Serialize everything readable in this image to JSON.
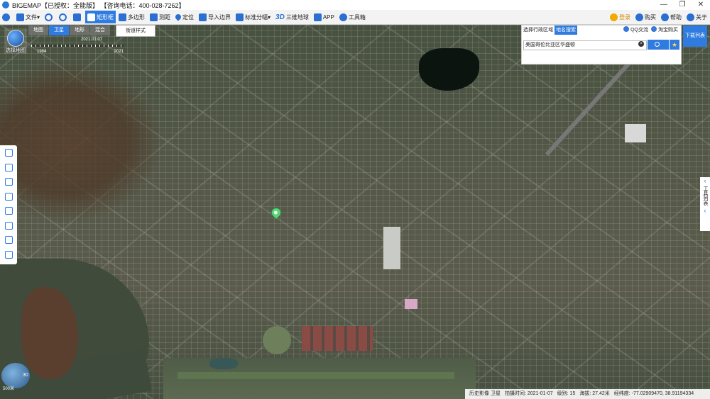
{
  "window": {
    "title": "BIGEMAP【已授权：全能版】 【咨询电话：400-028-7262】",
    "controls": [
      "—",
      "❐",
      "✕"
    ]
  },
  "toolbar": {
    "items": [
      {
        "label": "文件",
        "icon": "folder-icon"
      },
      {
        "label": "",
        "icon": "zoom-in-icon"
      },
      {
        "label": "",
        "icon": "zoom-out-icon"
      },
      {
        "label": "",
        "icon": "hand-icon"
      },
      {
        "label": "矩形框",
        "icon": "rectangle-icon",
        "active": true
      },
      {
        "label": "多边形",
        "icon": "polygon-icon"
      },
      {
        "label": "测距",
        "icon": "ruler-icon"
      },
      {
        "label": "定位",
        "icon": "pin-icon"
      },
      {
        "label": "导入边界",
        "icon": "import-icon"
      },
      {
        "label": "标准分幅",
        "icon": "grid-icon"
      },
      {
        "label": "三维地球",
        "icon": "3d-icon"
      },
      {
        "label": "APP",
        "icon": "phone-icon"
      },
      {
        "label": "工具箱",
        "icon": "gear-icon"
      }
    ],
    "right": [
      {
        "label": "登录",
        "icon": "user-icon"
      },
      {
        "label": "购买",
        "icon": "vip-icon"
      },
      {
        "label": "帮助",
        "icon": "help-icon"
      },
      {
        "label": "关于",
        "icon": "info-icon"
      }
    ]
  },
  "map_controls": {
    "select_map": "选择地图",
    "types": [
      "地图",
      "卫星",
      "地形",
      "混合"
    ],
    "active_type": "卫星",
    "street_style": "街道样式",
    "timeline": {
      "start": "1984",
      "end": "2021",
      "current": "2021.01.07"
    }
  },
  "search_panel": {
    "tabs": [
      "选择行政区域",
      "地名搜索"
    ],
    "active_tab": "地名搜索",
    "qq": "QQ交流",
    "taobao": "淘宝购买",
    "query": "美国哥伦比亚区华盛顿",
    "clear": "×",
    "star": "★"
  },
  "download_list": "下载列表",
  "right_panel": {
    "label": "工具列表"
  },
  "minimap": {
    "label": "30"
  },
  "scale": {
    "label": "500米"
  },
  "status": {
    "history": "历史影像 卫星",
    "date": "拍摄时间: 2021-01-07",
    "level": "级别: 15",
    "elevation": "海拔: 27.42米",
    "coords": "经纬度: -77.02909470, 38.91194334"
  }
}
